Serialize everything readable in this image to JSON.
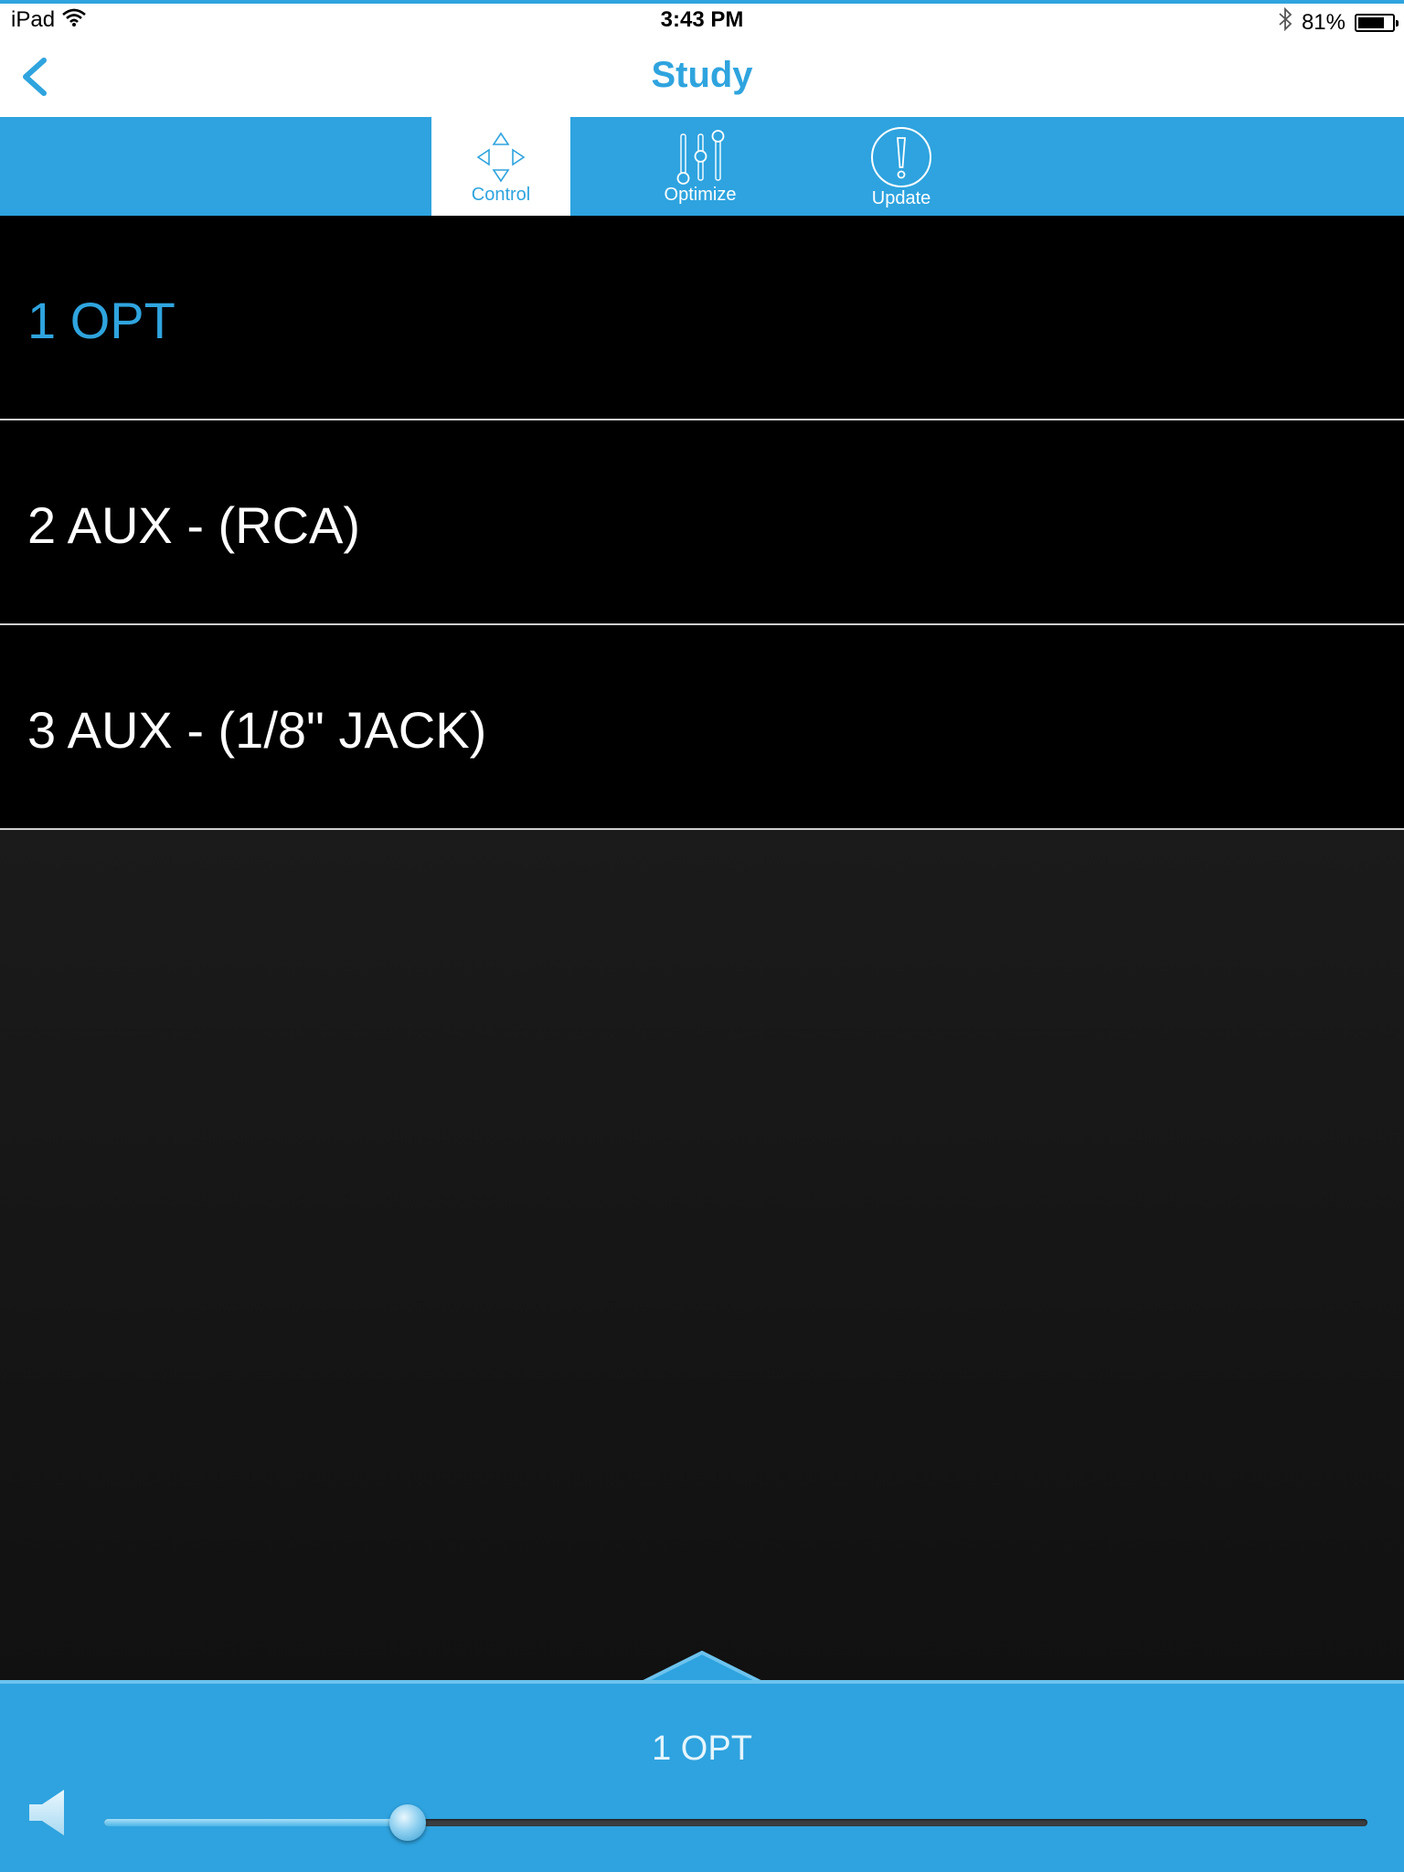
{
  "status_bar": {
    "device": "iPad",
    "time": "3:43 PM",
    "battery_text": "81%",
    "battery_level": 0.81
  },
  "nav": {
    "title": "Study",
    "back_icon": "chevron-left-icon"
  },
  "tabs": [
    {
      "label": "Control",
      "icon": "dpad-arrows-icon",
      "active": true
    },
    {
      "label": "Optimize",
      "icon": "sliders-icon",
      "active": false
    },
    {
      "label": "Update",
      "icon": "exclamation-circle-icon",
      "active": false
    }
  ],
  "inputs": [
    {
      "label": "1 OPT",
      "selected": true
    },
    {
      "label": "2 AUX - (RCA)",
      "selected": false
    },
    {
      "label": "3 AUX - (1/8\" JACK)",
      "selected": false
    }
  ],
  "player": {
    "now_playing": "1 OPT",
    "volume_level": 0.24
  },
  "colors": {
    "accent": "#2fa4de",
    "tab_bar": "#2ea3df",
    "list_bg": "#000000",
    "empty_bg": "#151515"
  }
}
